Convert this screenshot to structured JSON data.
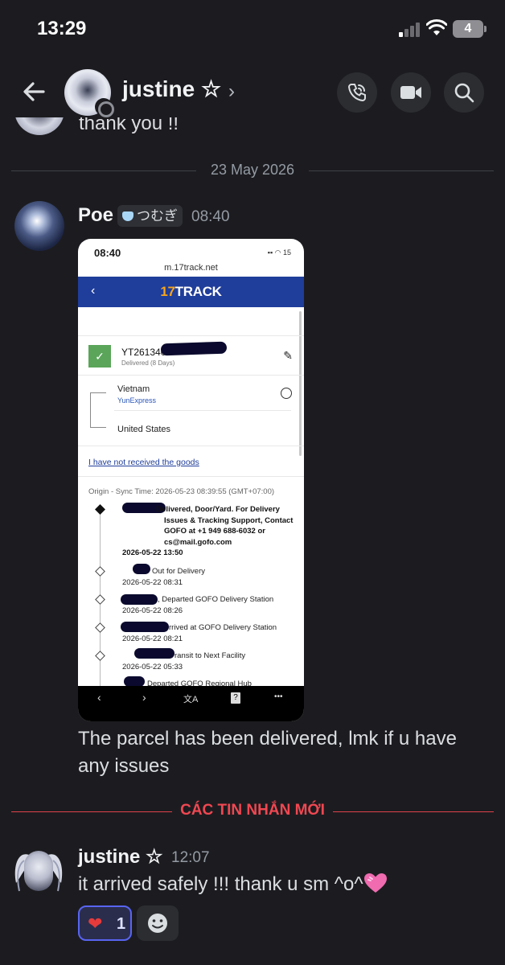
{
  "status_bar": {
    "time": "13:29",
    "battery": "4"
  },
  "header": {
    "name": "justine ☆",
    "chevron": "›"
  },
  "partial_message": {
    "text": "thank you !!"
  },
  "date_divider": "23 May 2026",
  "poe_message": {
    "author": "Poe",
    "tag": "つむぎ",
    "time": "08:40",
    "text": "The parcel has been delivered, lmk if u have any issues"
  },
  "screenshot": {
    "time": "08:40",
    "status_icons": "▪▪ ◠ 15",
    "url": "m.17track.net",
    "nav_back": "‹",
    "logo_num": "17",
    "logo_text": "TRACK",
    "check": "✓",
    "tracking_number": "YT261340",
    "delivery_status": "Delivered (8 Days)",
    "from_country": "Vietnam",
    "carrier": "YunExpress",
    "to_country": "United States",
    "not_received_link": "I have not received the goods",
    "origin_sync": "Origin - Sync Time: 2026-05-23 08:39:55 (GMT+07:00)",
    "events": [
      {
        "text": "Delivered, Door/Yard. For Delivery Issues & Tracking Support, Contact GOFO at +1 949 688-6032 or cs@mail.gofo.com",
        "time": "2026-05-22 13:50"
      },
      {
        "text": "Out for Delivery",
        "time": "2026-05-22 08:31"
      },
      {
        "text": ", Departed GOFO Delivery Station",
        "time": "2026-05-22 08:26"
      },
      {
        "text": "rrived at GOFO Delivery Station",
        "time": "2026-05-22 08:21"
      },
      {
        "text": "ransit to Next Facility",
        "time": "2026-05-22 05:33"
      },
      {
        "text": "Departed GOFO Regional Hub",
        "time": ""
      }
    ],
    "toolbar": [
      "‹",
      "›",
      "文A",
      "?",
      "•••"
    ]
  },
  "new_messages_divider": "CÁC TIN NHẮN MỚI",
  "justine_message": {
    "author": "justine ☆",
    "time": "12:07",
    "text": "it arrived safely !!! thank u sm ^o^"
  },
  "reaction": {
    "emoji": "❤",
    "count": "1"
  },
  "icons": {
    "back": "arrow-left-icon",
    "call": "phone-call-icon",
    "video": "video-camera-icon",
    "search": "search-icon",
    "sticker_heart": "pink-heart-icon",
    "add_reaction": "smiley-icon"
  },
  "colors": {
    "background": "#1c1c20",
    "new_divider": "#f04751",
    "reaction_accent": "#5865f2"
  }
}
